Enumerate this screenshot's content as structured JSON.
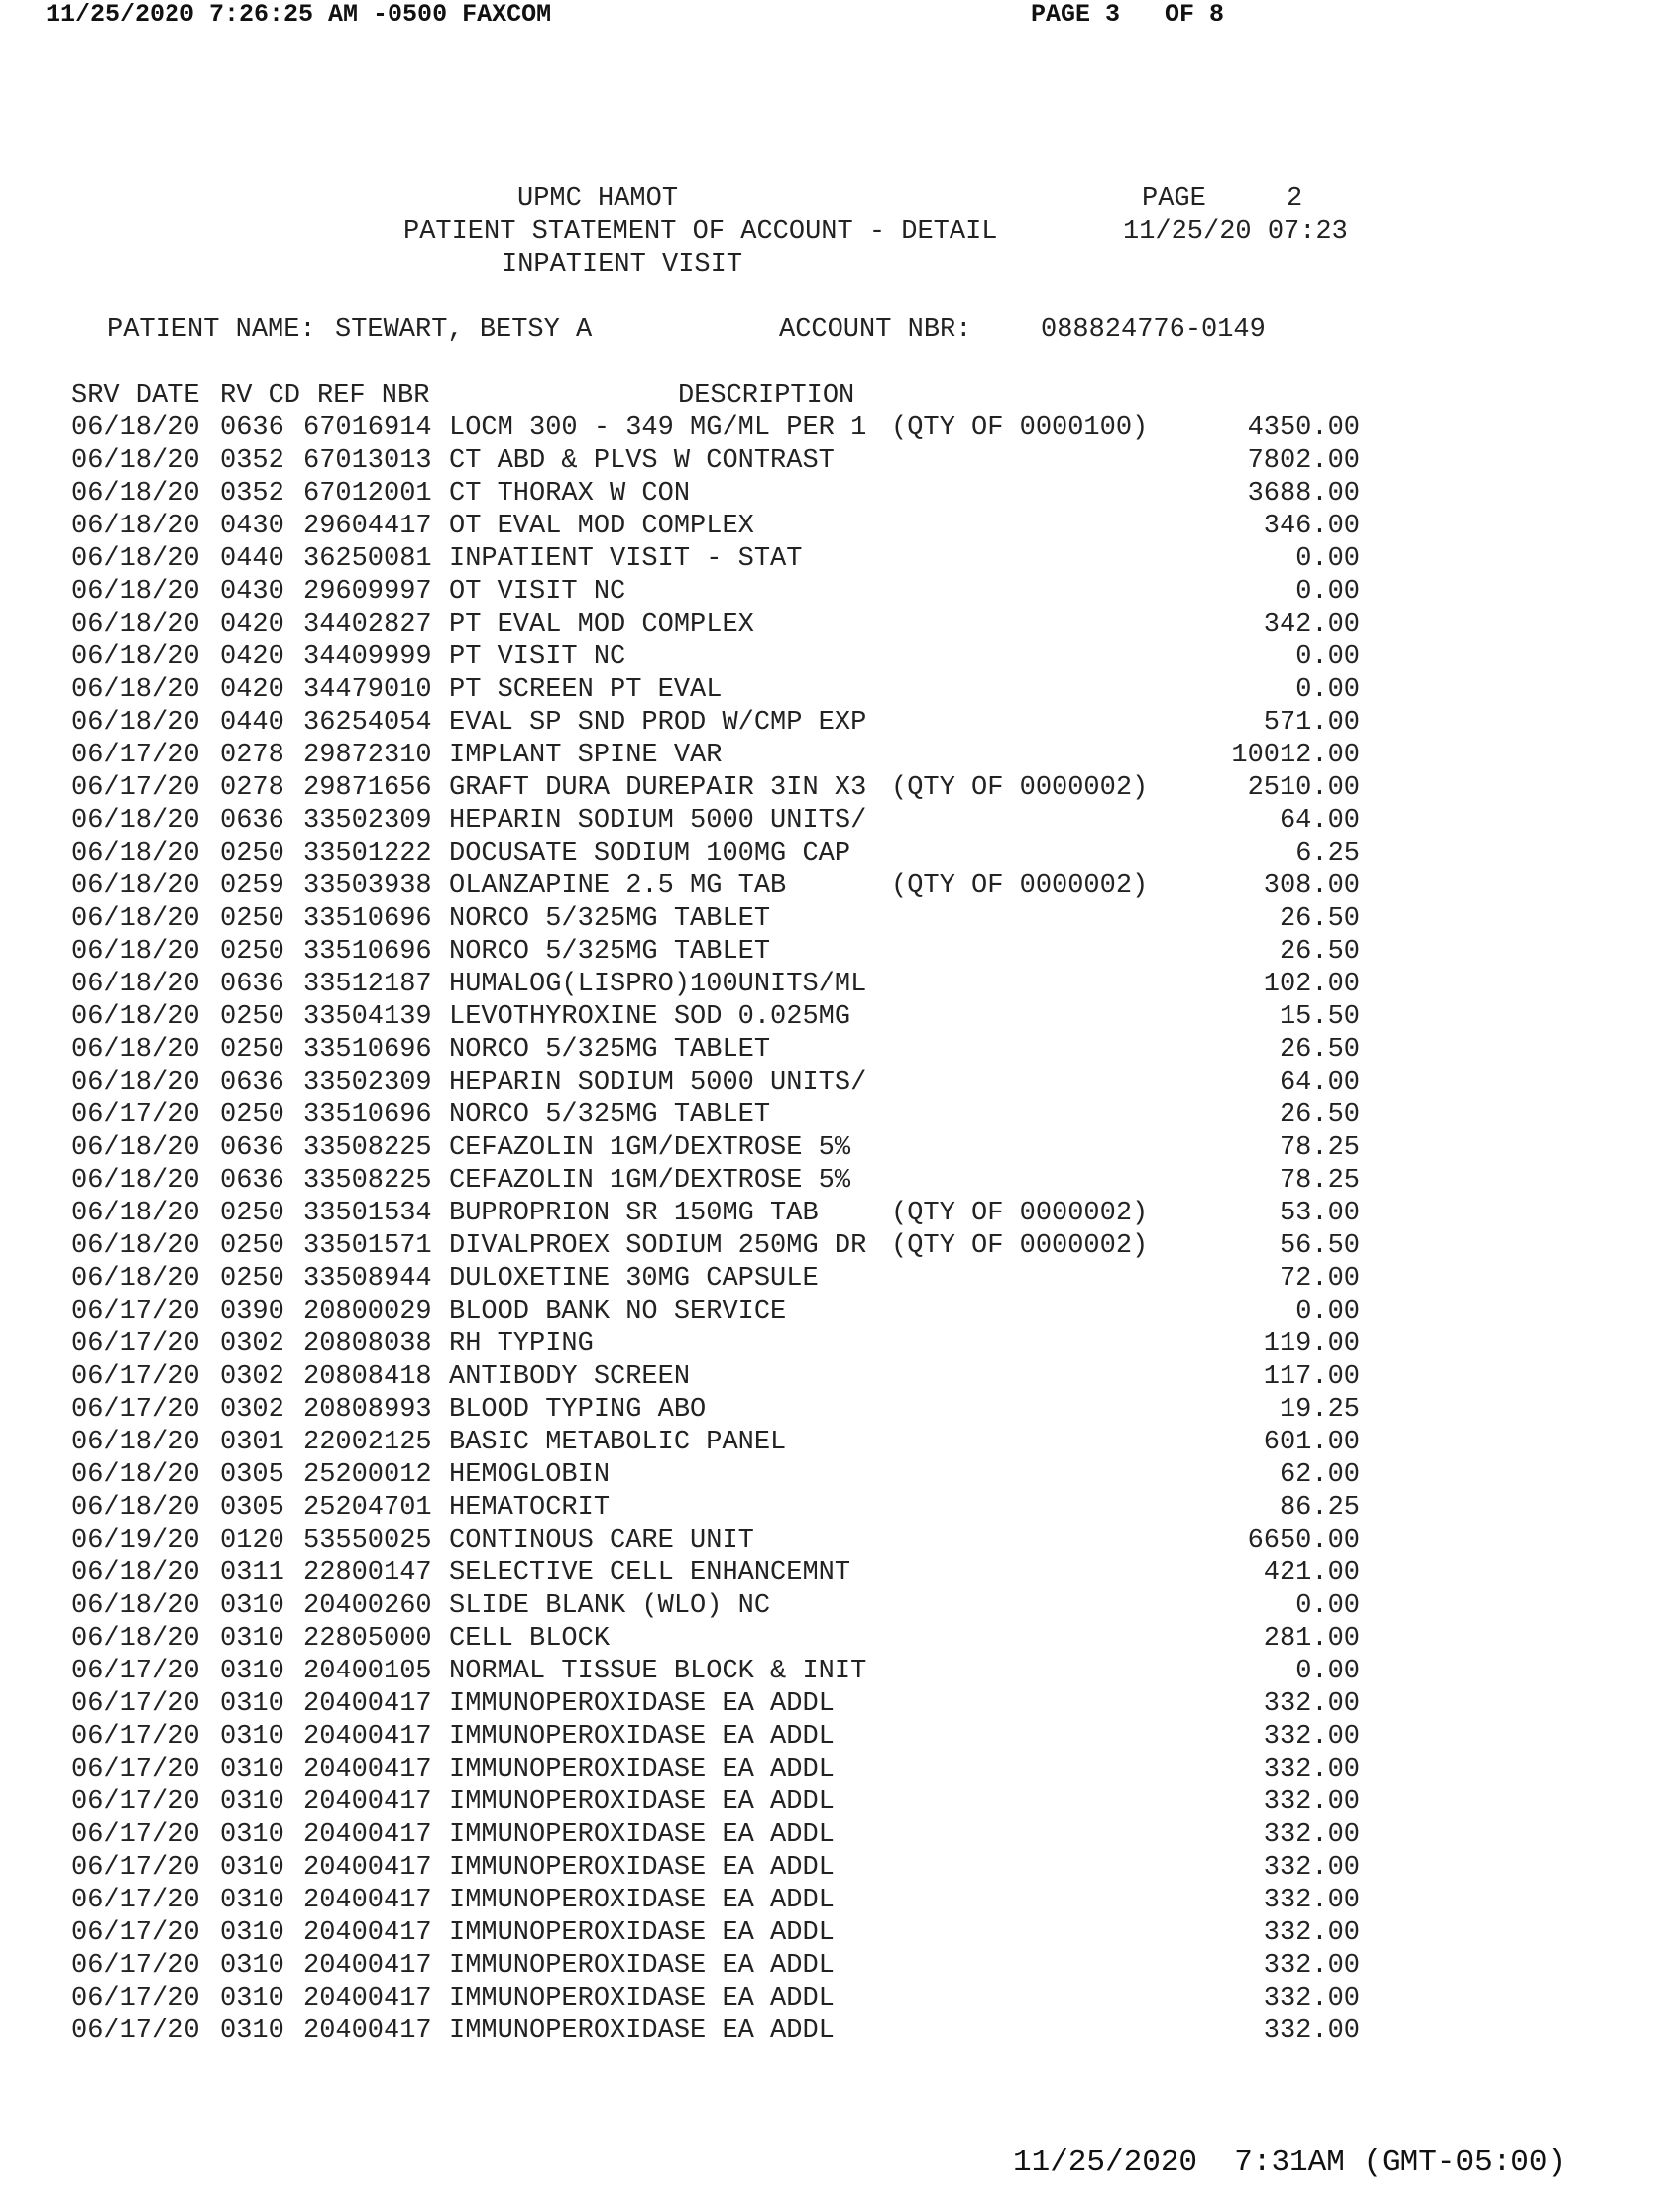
{
  "fax_header": {
    "timestamp": "11/25/2020 7:26:25 AM -0500 FAXCOM",
    "page_info": "PAGE 3   OF 8"
  },
  "statement_header": {
    "hospital": "UPMC HAMOT",
    "page_label": "PAGE",
    "page_number": "2",
    "title": "PATIENT STATEMENT OF ACCOUNT - DETAIL",
    "datetime": "11/25/20 07:23",
    "visit_type": "INPATIENT VISIT"
  },
  "patient": {
    "name_label": "PATIENT NAME:",
    "name": "STEWART, BETSY A",
    "account_label": "ACCOUNT NBR:",
    "account_number": "088824776-0149"
  },
  "columns": {
    "srv_date": "SRV DATE",
    "rv_cd": "RV CD",
    "ref_nbr": "REF NBR",
    "description": "DESCRIPTION"
  },
  "line_items": [
    {
      "date": "06/18/20",
      "rv": "0636",
      "ref": "67016914",
      "desc": "LOCM 300 - 349 MG/ML PER 1",
      "qty": "(QTY OF 0000100)",
      "amount": "4350.00"
    },
    {
      "date": "06/18/20",
      "rv": "0352",
      "ref": "67013013",
      "desc": "CT ABD & PLVS W CONTRAST",
      "qty": "",
      "amount": "7802.00"
    },
    {
      "date": "06/18/20",
      "rv": "0352",
      "ref": "67012001",
      "desc": "CT THORAX W CON",
      "qty": "",
      "amount": "3688.00"
    },
    {
      "date": "06/18/20",
      "rv": "0430",
      "ref": "29604417",
      "desc": "OT EVAL MOD COMPLEX",
      "qty": "",
      "amount": "346.00"
    },
    {
      "date": "06/18/20",
      "rv": "0440",
      "ref": "36250081",
      "desc": "INPATIENT VISIT - STAT",
      "qty": "",
      "amount": "0.00"
    },
    {
      "date": "06/18/20",
      "rv": "0430",
      "ref": "29609997",
      "desc": "OT VISIT NC",
      "qty": "",
      "amount": "0.00"
    },
    {
      "date": "06/18/20",
      "rv": "0420",
      "ref": "34402827",
      "desc": "PT EVAL MOD COMPLEX",
      "qty": "",
      "amount": "342.00"
    },
    {
      "date": "06/18/20",
      "rv": "0420",
      "ref": "34409999",
      "desc": "PT VISIT NC",
      "qty": "",
      "amount": "0.00"
    },
    {
      "date": "06/18/20",
      "rv": "0420",
      "ref": "34479010",
      "desc": "PT SCREEN PT EVAL",
      "qty": "",
      "amount": "0.00"
    },
    {
      "date": "06/18/20",
      "rv": "0440",
      "ref": "36254054",
      "desc": "EVAL SP SND PROD W/CMP EXP",
      "qty": "",
      "amount": "571.00"
    },
    {
      "date": "06/17/20",
      "rv": "0278",
      "ref": "29872310",
      "desc": "IMPLANT SPINE VAR",
      "qty": "",
      "amount": "10012.00"
    },
    {
      "date": "06/17/20",
      "rv": "0278",
      "ref": "29871656",
      "desc": "GRAFT DURA DUREPAIR 3IN X3",
      "qty": "(QTY OF 0000002)",
      "amount": "2510.00"
    },
    {
      "date": "06/18/20",
      "rv": "0636",
      "ref": "33502309",
      "desc": "HEPARIN SODIUM 5000 UNITS/",
      "qty": "",
      "amount": "64.00"
    },
    {
      "date": "06/18/20",
      "rv": "0250",
      "ref": "33501222",
      "desc": "DOCUSATE SODIUM 100MG CAP",
      "qty": "",
      "amount": "6.25"
    },
    {
      "date": "06/18/20",
      "rv": "0259",
      "ref": "33503938",
      "desc": "OLANZAPINE 2.5 MG TAB",
      "qty": "(QTY OF 0000002)",
      "amount": "308.00"
    },
    {
      "date": "06/18/20",
      "rv": "0250",
      "ref": "33510696",
      "desc": "NORCO 5/325MG TABLET",
      "qty": "",
      "amount": "26.50"
    },
    {
      "date": "06/18/20",
      "rv": "0250",
      "ref": "33510696",
      "desc": "NORCO 5/325MG TABLET",
      "qty": "",
      "amount": "26.50"
    },
    {
      "date": "06/18/20",
      "rv": "0636",
      "ref": "33512187",
      "desc": "HUMALOG(LISPRO)100UNITS/ML",
      "qty": "",
      "amount": "102.00"
    },
    {
      "date": "06/18/20",
      "rv": "0250",
      "ref": "33504139",
      "desc": "LEVOTHYROXINE SOD 0.025MG",
      "qty": "",
      "amount": "15.50"
    },
    {
      "date": "06/18/20",
      "rv": "0250",
      "ref": "33510696",
      "desc": "NORCO 5/325MG TABLET",
      "qty": "",
      "amount": "26.50"
    },
    {
      "date": "06/18/20",
      "rv": "0636",
      "ref": "33502309",
      "desc": "HEPARIN SODIUM 5000 UNITS/",
      "qty": "",
      "amount": "64.00"
    },
    {
      "date": "06/17/20",
      "rv": "0250",
      "ref": "33510696",
      "desc": "NORCO 5/325MG TABLET",
      "qty": "",
      "amount": "26.50"
    },
    {
      "date": "06/18/20",
      "rv": "0636",
      "ref": "33508225",
      "desc": "CEFAZOLIN 1GM/DEXTROSE 5%",
      "qty": "",
      "amount": "78.25"
    },
    {
      "date": "06/18/20",
      "rv": "0636",
      "ref": "33508225",
      "desc": "CEFAZOLIN 1GM/DEXTROSE 5%",
      "qty": "",
      "amount": "78.25"
    },
    {
      "date": "06/18/20",
      "rv": "0250",
      "ref": "33501534",
      "desc": "BUPROPRION SR 150MG TAB",
      "qty": "(QTY OF 0000002)",
      "amount": "53.00"
    },
    {
      "date": "06/18/20",
      "rv": "0250",
      "ref": "33501571",
      "desc": "DIVALPROEX SODIUM 250MG DR",
      "qty": "(QTY OF 0000002)",
      "amount": "56.50"
    },
    {
      "date": "06/18/20",
      "rv": "0250",
      "ref": "33508944",
      "desc": "DULOXETINE 30MG CAPSULE",
      "qty": "",
      "amount": "72.00"
    },
    {
      "date": "06/17/20",
      "rv": "0390",
      "ref": "20800029",
      "desc": "BLOOD BANK NO SERVICE",
      "qty": "",
      "amount": "0.00"
    },
    {
      "date": "06/17/20",
      "rv": "0302",
      "ref": "20808038",
      "desc": "RH TYPING",
      "qty": "",
      "amount": "119.00"
    },
    {
      "date": "06/17/20",
      "rv": "0302",
      "ref": "20808418",
      "desc": "ANTIBODY SCREEN",
      "qty": "",
      "amount": "117.00"
    },
    {
      "date": "06/17/20",
      "rv": "0302",
      "ref": "20808993",
      "desc": "BLOOD TYPING ABO",
      "qty": "",
      "amount": "19.25"
    },
    {
      "date": "06/18/20",
      "rv": "0301",
      "ref": "22002125",
      "desc": "BASIC METABOLIC PANEL",
      "qty": "",
      "amount": "601.00"
    },
    {
      "date": "06/18/20",
      "rv": "0305",
      "ref": "25200012",
      "desc": "HEMOGLOBIN",
      "qty": "",
      "amount": "62.00"
    },
    {
      "date": "06/18/20",
      "rv": "0305",
      "ref": "25204701",
      "desc": "HEMATOCRIT",
      "qty": "",
      "amount": "86.25"
    },
    {
      "date": "06/19/20",
      "rv": "0120",
      "ref": "53550025",
      "desc": "CONTINOUS CARE UNIT",
      "qty": "",
      "amount": "6650.00"
    },
    {
      "date": "06/18/20",
      "rv": "0311",
      "ref": "22800147",
      "desc": "SELECTIVE CELL ENHANCEMNT",
      "qty": "",
      "amount": "421.00"
    },
    {
      "date": "06/18/20",
      "rv": "0310",
      "ref": "20400260",
      "desc": "SLIDE BLANK (WLO) NC",
      "qty": "",
      "amount": "0.00"
    },
    {
      "date": "06/18/20",
      "rv": "0310",
      "ref": "22805000",
      "desc": "CELL BLOCK",
      "qty": "",
      "amount": "281.00"
    },
    {
      "date": "06/17/20",
      "rv": "0310",
      "ref": "20400105",
      "desc": "NORMAL TISSUE BLOCK & INIT",
      "qty": "",
      "amount": "0.00"
    },
    {
      "date": "06/17/20",
      "rv": "0310",
      "ref": "20400417",
      "desc": "IMMUNOPEROXIDASE EA ADDL",
      "qty": "",
      "amount": "332.00"
    },
    {
      "date": "06/17/20",
      "rv": "0310",
      "ref": "20400417",
      "desc": "IMMUNOPEROXIDASE EA ADDL",
      "qty": "",
      "amount": "332.00"
    },
    {
      "date": "06/17/20",
      "rv": "0310",
      "ref": "20400417",
      "desc": "IMMUNOPEROXIDASE EA ADDL",
      "qty": "",
      "amount": "332.00"
    },
    {
      "date": "06/17/20",
      "rv": "0310",
      "ref": "20400417",
      "desc": "IMMUNOPEROXIDASE EA ADDL",
      "qty": "",
      "amount": "332.00"
    },
    {
      "date": "06/17/20",
      "rv": "0310",
      "ref": "20400417",
      "desc": "IMMUNOPEROXIDASE EA ADDL",
      "qty": "",
      "amount": "332.00"
    },
    {
      "date": "06/17/20",
      "rv": "0310",
      "ref": "20400417",
      "desc": "IMMUNOPEROXIDASE EA ADDL",
      "qty": "",
      "amount": "332.00"
    },
    {
      "date": "06/17/20",
      "rv": "0310",
      "ref": "20400417",
      "desc": "IMMUNOPEROXIDASE EA ADDL",
      "qty": "",
      "amount": "332.00"
    },
    {
      "date": "06/17/20",
      "rv": "0310",
      "ref": "20400417",
      "desc": "IMMUNOPEROXIDASE EA ADDL",
      "qty": "",
      "amount": "332.00"
    },
    {
      "date": "06/17/20",
      "rv": "0310",
      "ref": "20400417",
      "desc": "IMMUNOPEROXIDASE EA ADDL",
      "qty": "",
      "amount": "332.00"
    },
    {
      "date": "06/17/20",
      "rv": "0310",
      "ref": "20400417",
      "desc": "IMMUNOPEROXIDASE EA ADDL",
      "qty": "",
      "amount": "332.00"
    },
    {
      "date": "06/17/20",
      "rv": "0310",
      "ref": "20400417",
      "desc": "IMMUNOPEROXIDASE EA ADDL",
      "qty": "",
      "amount": "332.00"
    }
  ],
  "footer": {
    "timestamp": "11/25/2020  7:31AM (GMT-05:00)"
  }
}
